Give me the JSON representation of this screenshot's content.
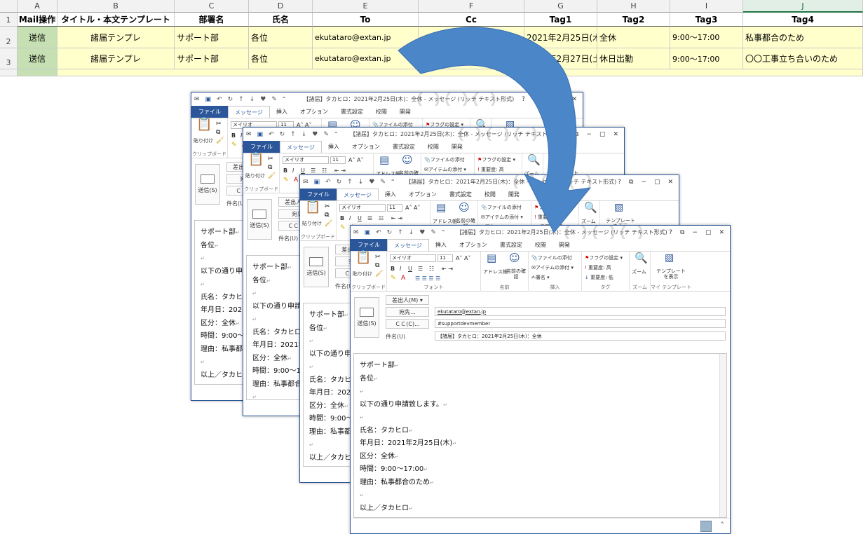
{
  "sheet": {
    "columns": [
      "A",
      "B",
      "C",
      "D",
      "E",
      "F",
      "G",
      "H",
      "I",
      "J"
    ],
    "rows": [
      "1",
      "2",
      "3",
      ""
    ],
    "headers": [
      "Mail操作",
      "タイトル・本文テンプレート",
      "部署名",
      "氏名",
      "To",
      "Cc",
      "Tag1",
      "Tag2",
      "Tag3",
      "Tag4"
    ],
    "data": [
      [
        "送信",
        "諸届テンプレ",
        "サポート部",
        "各位",
        "ekutataro@extan.jp",
        "",
        "2021年2月25日(木)",
        "全休",
        "9:00～17:00",
        "私事都合のため"
      ],
      [
        "送信",
        "諸届テンプレ",
        "サポート部",
        "各位",
        "ekutataro@extan.jp",
        "#supportdevmember",
        "2021年2月27日(土)",
        "休日出勤",
        "9:00～17:00",
        "〇〇工事立ち合いのため"
      ]
    ]
  },
  "window": {
    "title": "【諸届】タカヒロ：2021年2月25日(木)：全休 - メッセージ (リッチ テキスト形式)",
    "controls": [
      "?",
      "⧉",
      "−",
      "▢",
      "✕"
    ],
    "tabs": [
      "ファイル",
      "メッセージ",
      "挿入",
      "オプション",
      "書式設定",
      "校閲",
      "開発"
    ],
    "ribbon": {
      "paste": "貼り付け",
      "clipboard": "クリップボード",
      "font_name": "メイリオ",
      "font_size": "11",
      "font_group": "フォント",
      "address_book": "アドレス帳",
      "check_names": "名前の確認",
      "names_group": "名前",
      "attach_file": "ファイルの添付",
      "attach_item": "アイテムの添付",
      "signature": "署名",
      "insert_group": "挿入",
      "flag": "フラグの設定",
      "high": "重要度: 高",
      "low": "重要度: 低",
      "tags_group": "タグ",
      "zoom": "ズーム",
      "zoom_group": "ズーム",
      "template": "テンプレートを表示",
      "template_group": "マイ テンプレート"
    },
    "header": {
      "send": "送信(S)",
      "from": "差出人(M)",
      "to_btn": "宛先...",
      "cc_btn": "ＣＣ(C)...",
      "subject_label": "件名(U)",
      "to_value": "ekutataro@extan.jp",
      "cc_value": "#supportdevmember",
      "subject_value": "【諸届】タカヒロ：2021年2月25日(木)：全休"
    },
    "body": [
      "サポート部",
      "各位",
      "",
      "以下の通り申請致します。",
      "",
      "氏名：タカヒロ",
      "年月日：2021年2月25日(木)",
      "区分：全休",
      "時間：9:00～17:00",
      "理由：私事都合のため",
      "",
      "以上／タカヒロ"
    ]
  },
  "colors": {
    "file_tab": "#2b579a",
    "header_fill": "#ffffcc",
    "send_fill": "#c6e0b4",
    "arrow": "#4a86c8"
  }
}
